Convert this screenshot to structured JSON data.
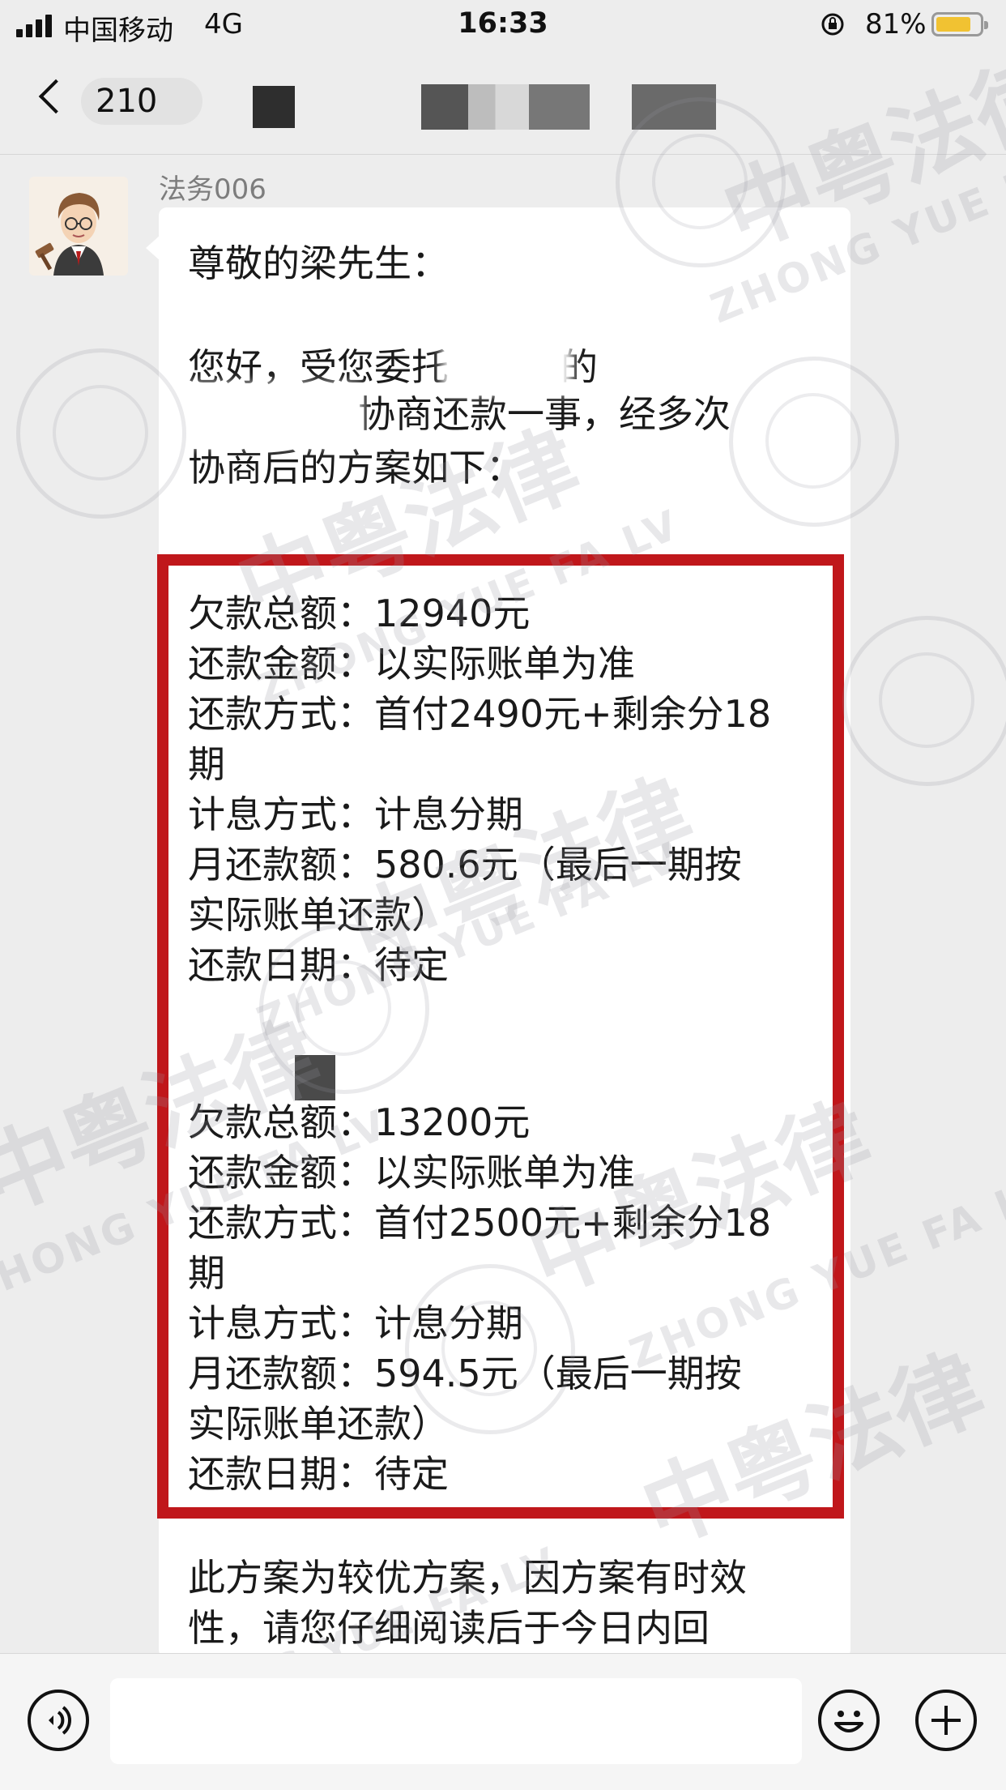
{
  "status_bar": {
    "carrier": "中国移动",
    "network": "4G",
    "time": "16:33",
    "battery_percent": "81%",
    "battery_level": 0.81,
    "battery_color": "#f1c232"
  },
  "nav": {
    "back_icon": "chevron-left-icon",
    "unread_count": "210"
  },
  "chat": {
    "sender_name": "法务006",
    "message": {
      "greeting": "尊敬的梁先生：",
      "intro_line1": "您好，受您委托给我司的",
      "intro_line2": "协商还款一事，经多次",
      "intro_line3": "协商后的方案如下：",
      "plan1": {
        "total_debt": "欠款总额：12940元",
        "repay_amount": "还款金额：以实际账单为准",
        "repay_method": "还款方式：首付2490元+剩余分18",
        "repay_method_cont": "期",
        "interest_method": "计息方式：计息分期",
        "monthly": "月还款额：580.6元（最后一期按",
        "monthly_cont": "实际账单还款）",
        "date": "还款日期：待定"
      },
      "plan2": {
        "total_debt": "欠款总额：13200元",
        "repay_amount": "还款金额：以实际账单为准",
        "repay_method": "还款方式：首付2500元+剩余分18",
        "repay_method_cont": "期",
        "interest_method": "计息方式：计息分期",
        "monthly": "月还款额：594.5元（最后一期按",
        "monthly_cont": "实际账单还款）",
        "date": "还款日期：待定"
      },
      "footer_line1": "此方案为较优方案，因方案有时效",
      "footer_line2": "性，请您仔细阅读后于今日内回"
    },
    "highlight_color": "#c0171b"
  },
  "watermark": {
    "cn": "中粤法律",
    "en": "ZHONG YUE FA LV"
  },
  "input_bar": {
    "voice_icon": "voice-icon",
    "emoji_icon": "emoji-icon",
    "plus_icon": "plus-icon"
  }
}
